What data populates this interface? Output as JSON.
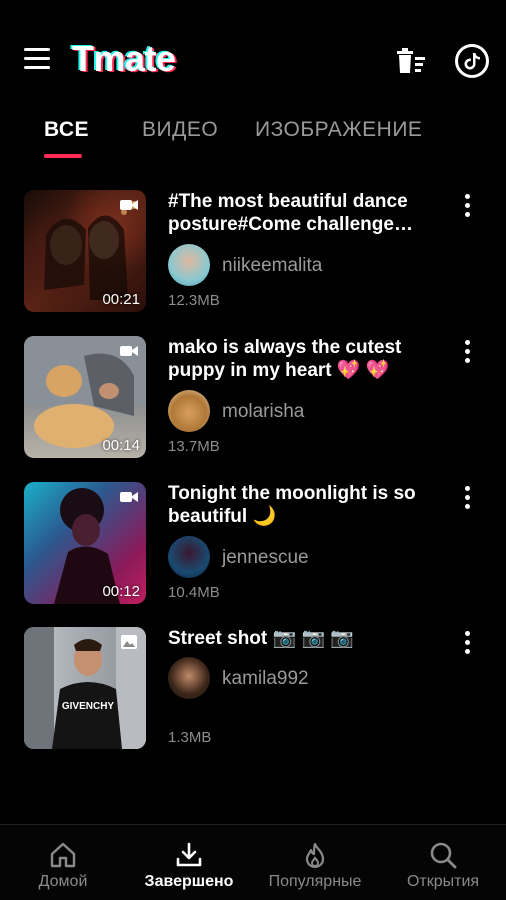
{
  "header": {
    "app_title": "Tmate",
    "icons": [
      "menu-icon",
      "delete-list-icon",
      "tiktok-icon"
    ]
  },
  "tabs": [
    {
      "label": "ВСЕ",
      "active": true
    },
    {
      "label": "ВИДЕО",
      "active": false
    },
    {
      "label": "ИЗОБРАЖЕНИЕ",
      "active": false
    }
  ],
  "items": [
    {
      "title": "#The most beautiful dance posture#Come challenge…",
      "author": "niikeemalita",
      "size": "12.3MB",
      "duration": "00:21",
      "type": "video"
    },
    {
      "title": "mako is always the cutest puppy in my heart 💖 💖",
      "author": "molarisha",
      "size": "13.7MB",
      "duration": "00:14",
      "type": "video"
    },
    {
      "title": "Tonight the moonlight is so beautiful 🌙",
      "author": "jennescue",
      "size": "10.4MB",
      "duration": "00:12",
      "type": "video"
    },
    {
      "title": "Street shot 📷 📷 📷",
      "author": "kamila992",
      "size": "1.3MB",
      "duration": "",
      "type": "image",
      "thumb_text": "GIVENCHY"
    }
  ],
  "bottom_nav": [
    {
      "label": "Домой",
      "icon": "home-icon",
      "active": false
    },
    {
      "label": "Завершено",
      "icon": "download-icon",
      "active": true
    },
    {
      "label": "Популярные",
      "icon": "flame-icon",
      "active": false
    },
    {
      "label": "Открытия",
      "icon": "search-icon",
      "active": false
    }
  ],
  "colors": {
    "background": "#000000",
    "accent": "#fe2c55",
    "logo_cyan": "#25f4ee",
    "muted_text": "#9a9a9a"
  }
}
